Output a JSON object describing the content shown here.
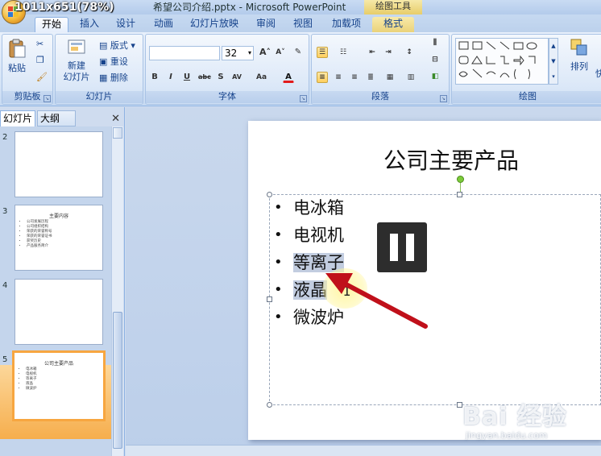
{
  "overlay": {
    "resolution": "1011x651(78%)"
  },
  "titlebar": {
    "title": "希望公司介绍.pptx - Microsoft PowerPoint",
    "context_tool": "绘图工具"
  },
  "tabs": [
    {
      "label": "开始",
      "active": true
    },
    {
      "label": "插入"
    },
    {
      "label": "设计"
    },
    {
      "label": "动画"
    },
    {
      "label": "幻灯片放映"
    },
    {
      "label": "审阅"
    },
    {
      "label": "视图"
    },
    {
      "label": "加载项"
    },
    {
      "label": "格式"
    }
  ],
  "ribbon": {
    "clipboard": {
      "label": "剪贴板",
      "paste": "粘贴"
    },
    "slides": {
      "label": "幻灯片",
      "new_slide_line1": "新建",
      "new_slide_line2": "幻灯片",
      "layout": "版式",
      "reset": "重设",
      "delete": "删除"
    },
    "font": {
      "label": "字体",
      "font_size": "32",
      "font_name": ""
    },
    "paragraph": {
      "label": "段落"
    },
    "drawing": {
      "label": "绘图",
      "arrange": "排列",
      "quick": "快"
    }
  },
  "leftpanel": {
    "tab_slides": "幻灯片",
    "tab_outline": "大纲",
    "close": "✕",
    "thumbnails": [
      {
        "num": "2",
        "title": "",
        "items": []
      },
      {
        "num": "3",
        "title": "主要内容",
        "items": [
          "公司发展历程",
          "公司组织结构",
          "荣获的荣誉称号",
          "荣获的荣誉证书",
          "获奖历史",
          "产品服务简介"
        ]
      },
      {
        "num": "4",
        "title": "",
        "items": []
      },
      {
        "num": "5",
        "title": "公司主要产品",
        "items": [
          "电冰箱",
          "电视机",
          "等离子",
          "液晶",
          "微波炉"
        ]
      }
    ]
  },
  "slide": {
    "title": "公司主要产品",
    "bullets": [
      "电冰箱",
      "电视机",
      "等离子",
      "液晶",
      "微波炉"
    ]
  },
  "watermark": {
    "brand": "Bai 经验",
    "url": "jingyan.baidu.com"
  }
}
